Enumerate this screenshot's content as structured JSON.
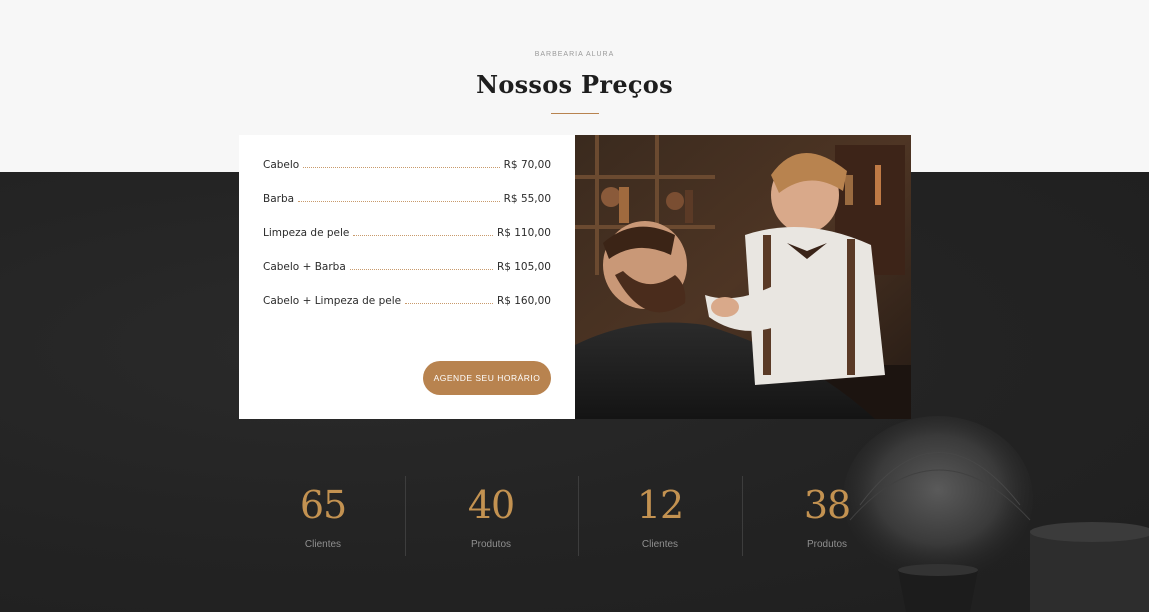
{
  "header": {
    "eyebrow": "BARBEARIA ALURA",
    "title": "Nossos Preços"
  },
  "prices": [
    {
      "name": "Cabelo",
      "value": "R$ 70,00"
    },
    {
      "name": "Barba",
      "value": "R$ 55,00"
    },
    {
      "name": "Limpeza de pele",
      "value": "R$ 110,00"
    },
    {
      "name": "Cabelo + Barba",
      "value": "R$ 105,00"
    },
    {
      "name": "Cabelo + Limpeza de pele",
      "value": "R$ 160,00"
    }
  ],
  "cta": {
    "label": "AGENDE SEU HORÁRIO"
  },
  "stats": [
    {
      "number": "65",
      "label": "Clientes"
    },
    {
      "number": "40",
      "label": "Produtos"
    },
    {
      "number": "12",
      "label": "Clientes"
    },
    {
      "number": "38",
      "label": "Produtos"
    }
  ],
  "colors": {
    "accent": "#b8834f",
    "stat_number": "#c39251",
    "dark_background": "#242424",
    "light_background": "#f7f7f7"
  },
  "images": {
    "photo": "barber-trimming-beard-photo",
    "decor": "shaving-brush-photo"
  }
}
